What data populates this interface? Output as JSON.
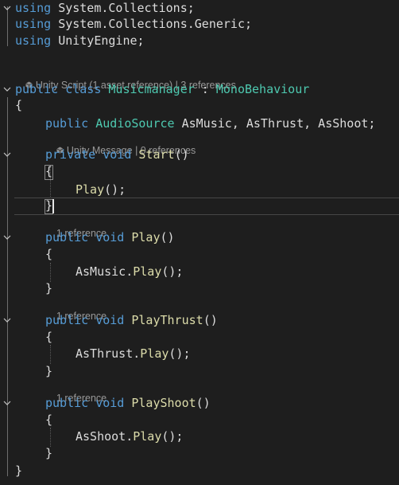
{
  "editor": {
    "usings": [
      {
        "kw": "using",
        "ns": "System.Collections",
        "end": ";"
      },
      {
        "kw": "using",
        "ns": "System.Collections.Generic",
        "end": ";"
      },
      {
        "kw": "using",
        "ns": "UnityEngine",
        "end": ";"
      }
    ],
    "class_lens": {
      "part1": "Unity Script (1 asset reference)",
      "sep": " | ",
      "part2": "3 references"
    },
    "class_decl": {
      "mod": "public",
      "kw": "class",
      "name": "Musicmanager",
      "colon": " : ",
      "base": "MonoBehaviour"
    },
    "brace_open": "{",
    "brace_close": "}",
    "field": {
      "mod": "public",
      "type": "AudioSource",
      "names": "AsMusic, AsThrust, AsShoot;"
    },
    "start_lens": {
      "part1": "Unity Message",
      "sep": " | ",
      "part2": "0 references"
    },
    "start_decl": {
      "mod": "private",
      "ret": "void",
      "name": "Start",
      "parens": "()"
    },
    "start_body": {
      "call": "Play",
      "rest": "();"
    },
    "methods": [
      {
        "lens": "1 reference",
        "mod": "public",
        "ret": "void",
        "name": "Play",
        "parens": "()",
        "obj": "AsMusic",
        "dot": ".",
        "call": "Play",
        "rest": "();"
      },
      {
        "lens": "1 reference",
        "mod": "public",
        "ret": "void",
        "name": "PlayThrust",
        "parens": "()",
        "obj": "AsThrust",
        "dot": ".",
        "call": "Play",
        "rest": "();"
      },
      {
        "lens": "1 reference",
        "mod": "public",
        "ret": "void",
        "name": "PlayShoot",
        "parens": "()",
        "obj": "AsShoot",
        "dot": ".",
        "call": "Play",
        "rest": "();"
      }
    ]
  },
  "colors": {
    "background": "#1e1e1e",
    "keyword": "#569cd6",
    "type": "#4ec9b0",
    "method": "#dcdcaa",
    "text": "#dcdcdc",
    "codelens": "#999999"
  },
  "icons": [
    "chevron-down-icon",
    "unity-cube-icon"
  ]
}
